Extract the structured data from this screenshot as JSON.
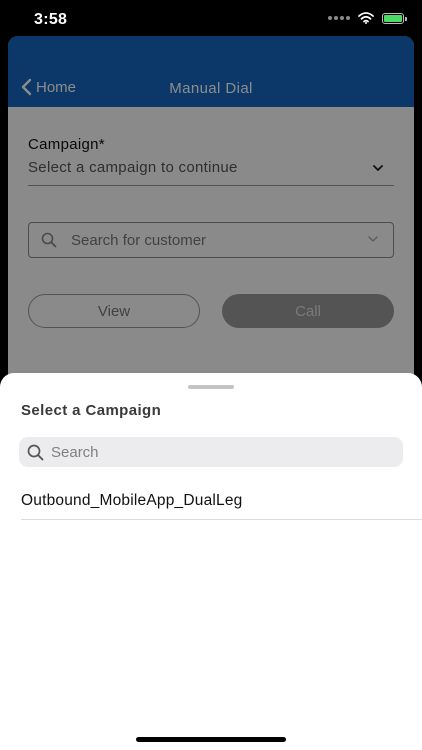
{
  "status_bar": {
    "time": "3:58",
    "icons": [
      "signal-dots-icon",
      "wifi-icon",
      "battery-charging-icon"
    ]
  },
  "nav": {
    "back_label": "Home",
    "title": "Manual Dial"
  },
  "form": {
    "campaign_label": "Campaign*",
    "campaign_placeholder": "Select a campaign to continue",
    "customer_search_placeholder": "Search for customer",
    "view_button": "View",
    "call_button": "Call"
  },
  "sheet": {
    "title": "Select a Campaign",
    "search_placeholder": "Search",
    "items": [
      {
        "label": "Outbound_MobileApp_DualLeg"
      }
    ]
  },
  "colors": {
    "nav_bar": "#1565c0",
    "battery_fill": "#4cd964",
    "call_button_disabled": "#9a9a9a"
  }
}
